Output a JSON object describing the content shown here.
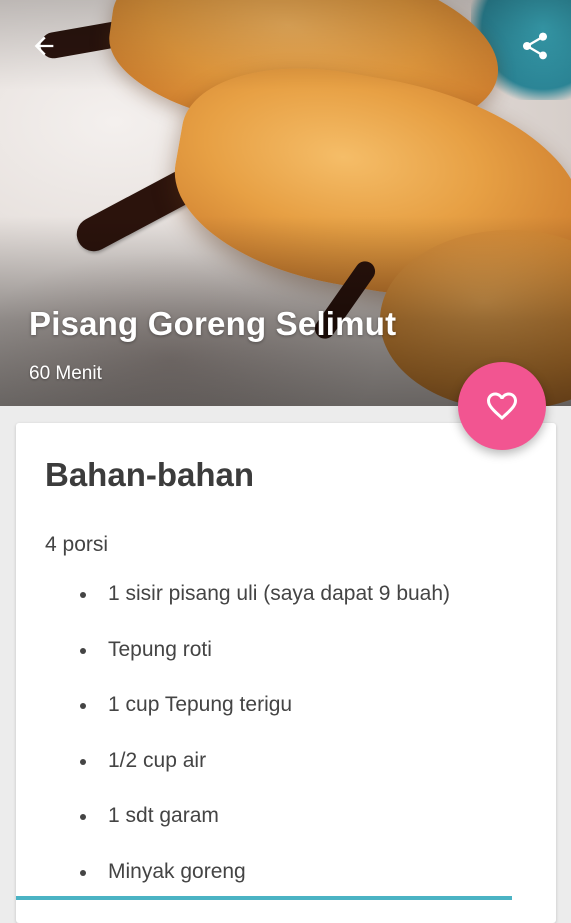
{
  "header": {
    "back_icon": "arrow-left-icon",
    "share_icon": "share-icon"
  },
  "recipe": {
    "title": "Pisang Goreng Selimut",
    "duration": "60 Menit"
  },
  "favorite": {
    "icon": "heart-outline-icon",
    "color": "#f25591"
  },
  "ingredients_section": {
    "heading": "Bahan-bahan",
    "servings": "4 porsi",
    "items": [
      "1 sisir pisang uli (saya dapat 9 buah)",
      "Tepung roti",
      "1 cup Tepung terigu",
      "1/2 cup air",
      "1 sdt garam",
      "Minyak goreng"
    ]
  }
}
